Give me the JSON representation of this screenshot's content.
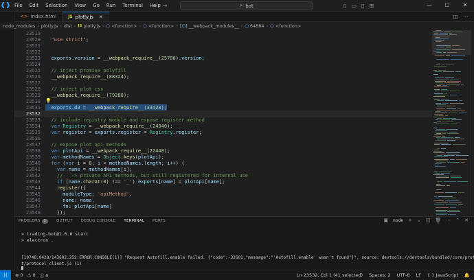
{
  "menu": [
    "File",
    "Edit",
    "Selection",
    "View",
    "Go",
    "Run",
    "Terminal",
    "Help"
  ],
  "search": {
    "text": "bot"
  },
  "tabs": [
    {
      "label": "index.html",
      "type": "html"
    },
    {
      "label": "plotly.js",
      "type": "js"
    }
  ],
  "breadcrumb": [
    "node_modules",
    "plotly.js",
    "dist",
    "plotly.js",
    "<function>",
    "<function>",
    "__webpack_modules__",
    "64884",
    "<function>"
  ],
  "code_lines": [
    {
      "n": "23519",
      "t": ""
    },
    {
      "n": "23520",
      "t": "  \"use strict\";"
    },
    {
      "n": "23521",
      "t": ""
    },
    {
      "n": "23522",
      "t": ""
    },
    {
      "n": "23523",
      "t": "  exports.version = __webpack_require__(25788).version;"
    },
    {
      "n": "23524",
      "t": ""
    },
    {
      "n": "23525",
      "t": "  // inject promise polyfill"
    },
    {
      "n": "23526",
      "t": "  __webpack_require__(88324);"
    },
    {
      "n": "23527",
      "t": ""
    },
    {
      "n": "23528",
      "t": "  // inject plot css"
    },
    {
      "n": "23529",
      "t": "  __webpack_require__(79288);"
    },
    {
      "n": "23530",
      "t": ""
    },
    {
      "n": "23531",
      "t": "  exports.d3 = __webpack_require__(33428);"
    },
    {
      "n": "23532",
      "t": ""
    },
    {
      "n": "23533",
      "t": "  // include registry module and expose register method"
    },
    {
      "n": "23534",
      "t": "  var Registry = __webpack_require__(24040);"
    },
    {
      "n": "23535",
      "t": "  var register = exports.register = Registry.register;"
    },
    {
      "n": "23536",
      "t": ""
    },
    {
      "n": "23537",
      "t": "  // expose plot api methods"
    },
    {
      "n": "23538",
      "t": "  var plotApi = __webpack_require__(22448);"
    },
    {
      "n": "23539",
      "t": "  var methodNames = Object.keys(plotApi);"
    },
    {
      "n": "23540",
      "t": "  for (var i = 0; i < methodNames.length; i++) {"
    },
    {
      "n": "23541",
      "t": "    var name = methodNames[i];"
    },
    {
      "n": "23542",
      "t": "    // _ -> private API methods, but still registered for internal use"
    },
    {
      "n": "23543",
      "t": "    if (name.charAt(0) !== '_') exports[name] = plotApi[name];"
    },
    {
      "n": "23544",
      "t": "    register({"
    },
    {
      "n": "23545",
      "t": "      moduleType: 'apiMethod',"
    },
    {
      "n": "23546",
      "t": "      name: name,"
    },
    {
      "n": "23547",
      "t": "      fn: plotApi[name]"
    },
    {
      "n": "23548",
      "t": "    });"
    }
  ],
  "panel": {
    "tabs": [
      "PROBLEMS",
      "OUTPUT",
      "DEBUG CONSOLE",
      "TERMINAL",
      "PORTS"
    ],
    "problems_count": "1",
    "active": "TERMINAL",
    "shell": "node"
  },
  "terminal_lines": [
    "> trading-bot@1.0.0 start",
    "> electron .",
    "",
    "",
    "[19748:0428/143602.252:ERROR:CONSOLE(1)] \"Request Autofill.enable failed. {\"code\":-32601,\"message\":\"'Autofill.enable' wasn't found\"}\", source: devtools://devtools/bundled/core/protocol_clien",
    "t/protocol_client.js (1)"
  ],
  "status": {
    "errors": "0",
    "warnings": "0",
    "info": "0",
    "position": "Ln 23532, Col 1 (41 selected)",
    "spaces": "Spaces: 2",
    "encoding": "UTF-8",
    "eol": "LF",
    "language": "JavaScript"
  }
}
